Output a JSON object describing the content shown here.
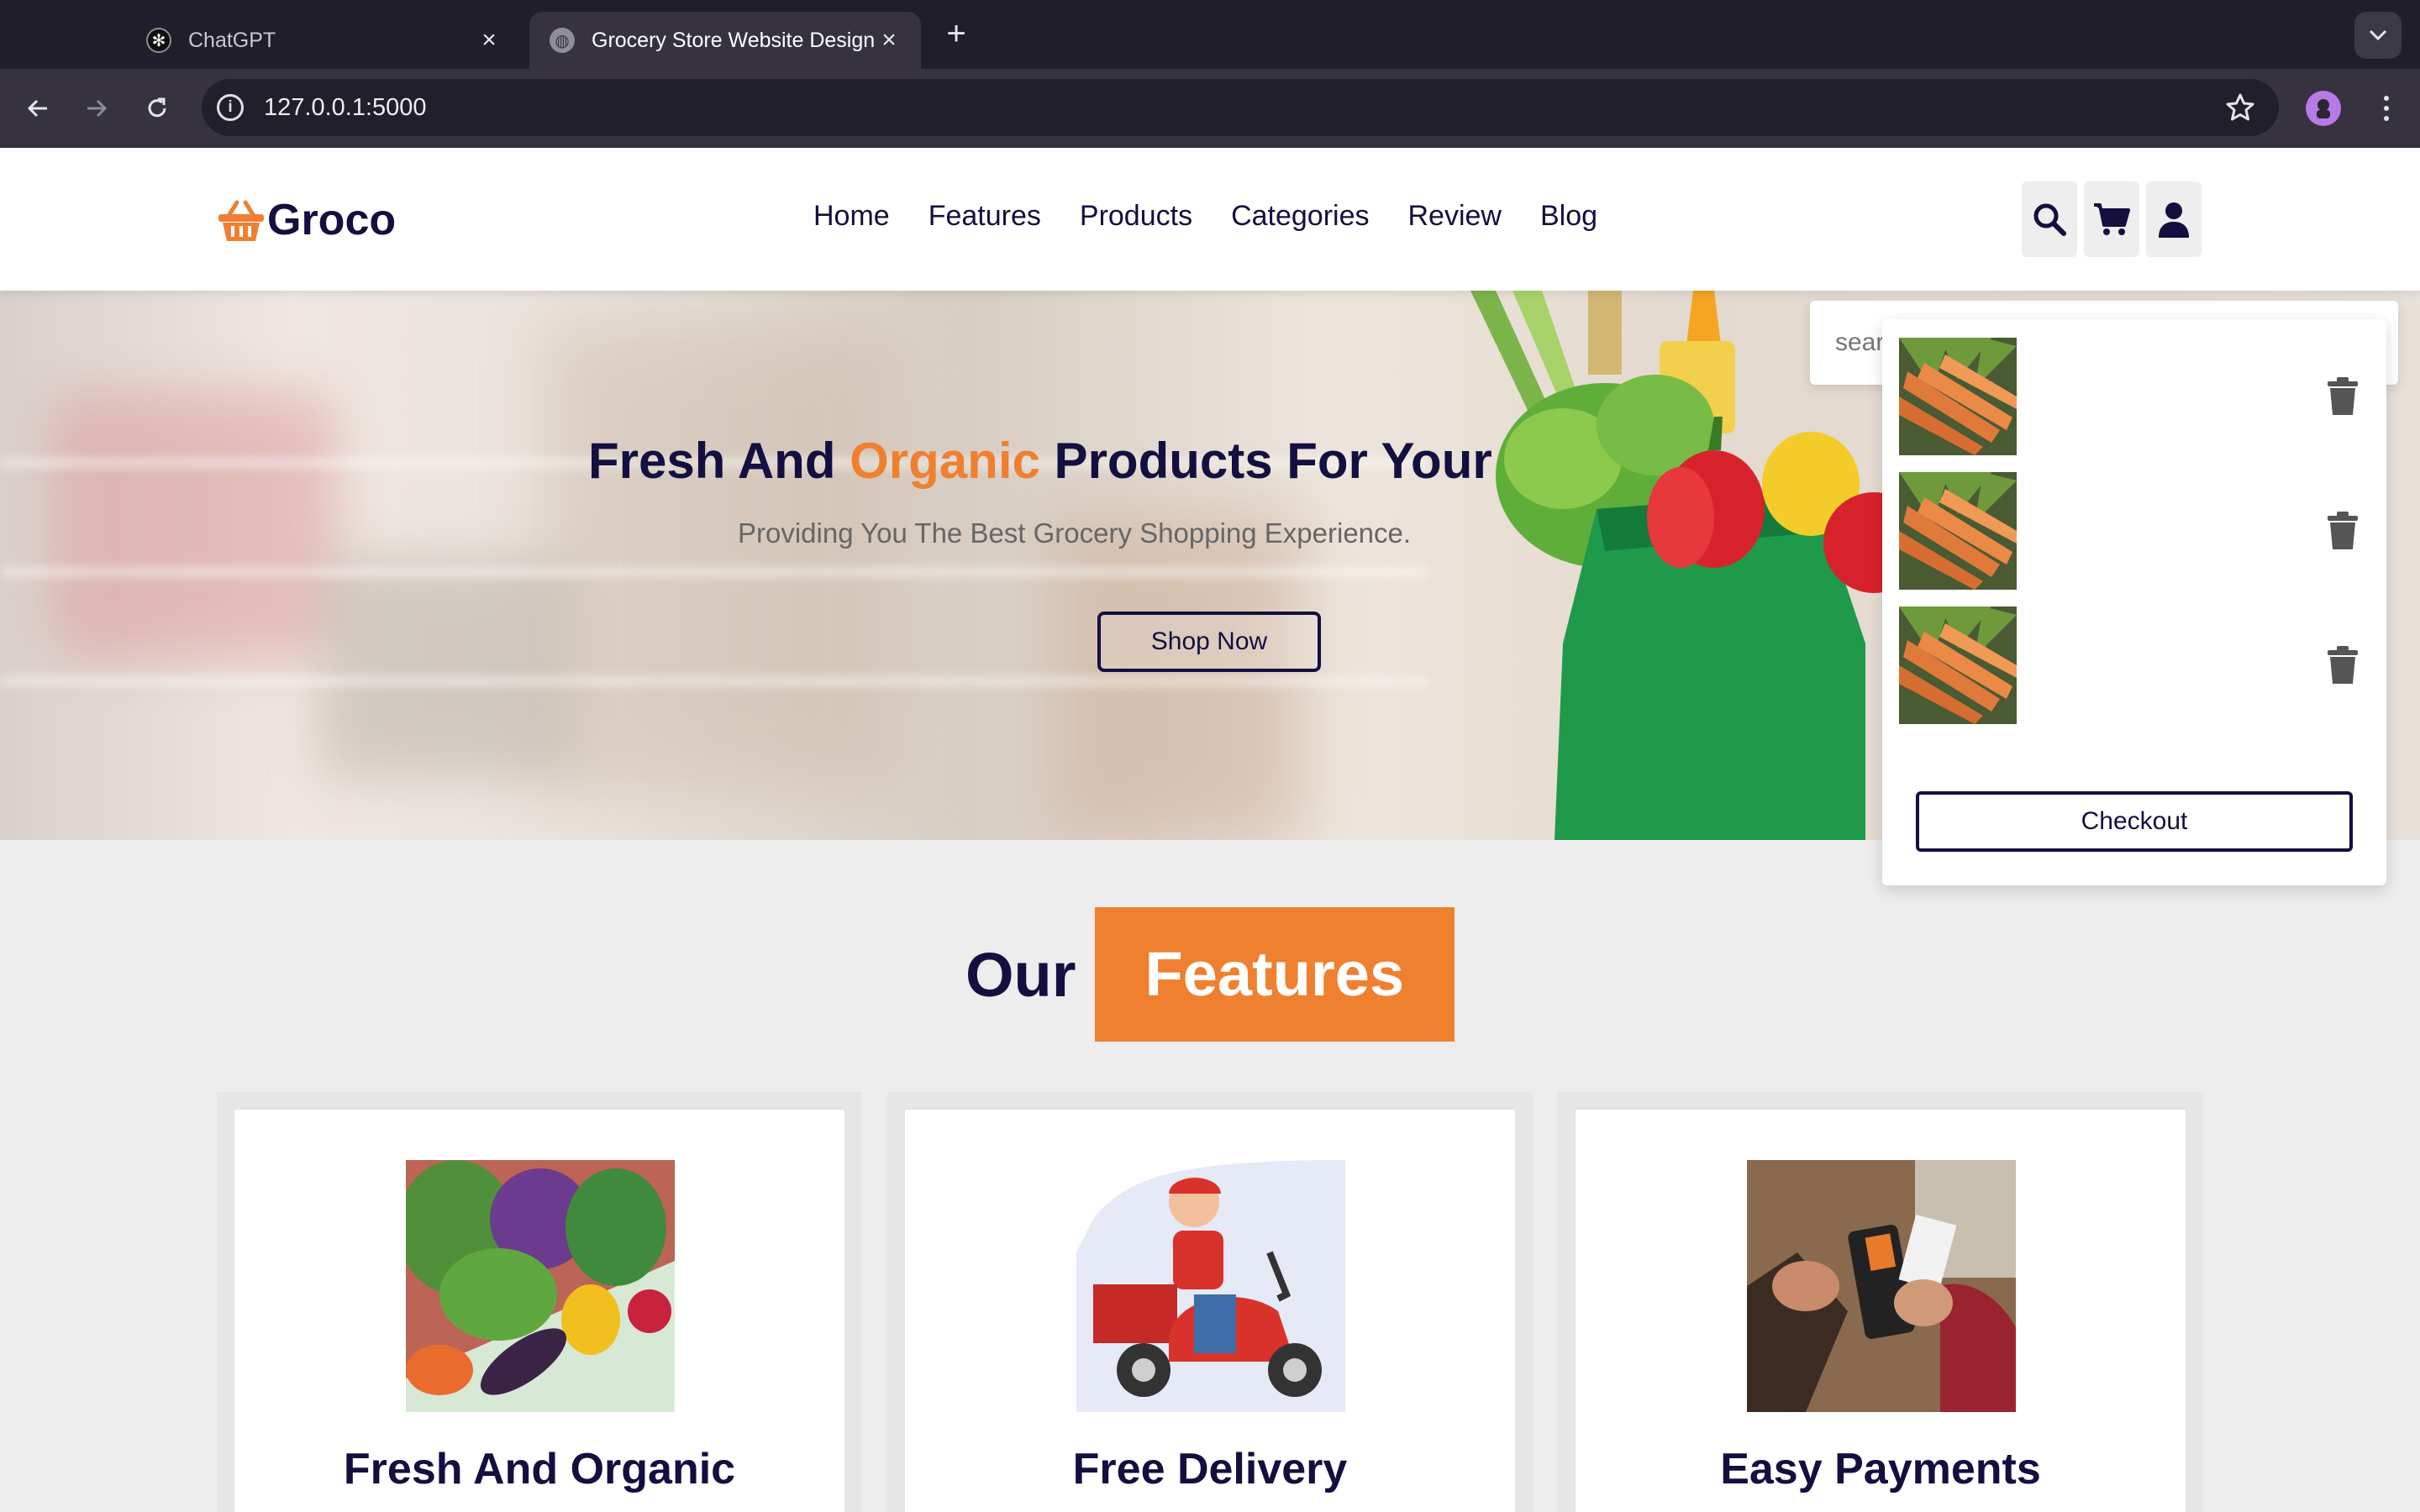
{
  "browser": {
    "tabs": [
      {
        "title": "ChatGPT",
        "active": false
      },
      {
        "title": "Grocery Store Website Design",
        "active": true
      }
    ],
    "url": "127.0.0.1:5000"
  },
  "site": {
    "brand": "Groco",
    "nav": [
      "Home",
      "Features",
      "Products",
      "Categories",
      "Review",
      "Blog"
    ]
  },
  "search": {
    "placeholder": "search here..."
  },
  "hero": {
    "heading_before": "Fresh And ",
    "heading_accent": "Organic",
    "heading_after": " Products For Your",
    "subtitle": "Providing You The Best Grocery Shopping Experience.",
    "cta": "Shop Now"
  },
  "cart": {
    "items": [
      {
        "image": "carrots"
      },
      {
        "image": "carrots"
      },
      {
        "image": "carrots"
      }
    ],
    "checkout_label": "Checkout"
  },
  "features": {
    "title_plain": "Our",
    "title_highlight": "Features",
    "cards": [
      {
        "title": "Fresh And Organic",
        "image": "vegetable-crate"
      },
      {
        "title": "Free Delivery",
        "image": "scooter-courier"
      },
      {
        "title": "Easy Payments",
        "image": "card-payment"
      }
    ]
  },
  "colors": {
    "accent": "#ef8030",
    "brand_dark": "#130f40",
    "page_bg": "#ededed"
  }
}
